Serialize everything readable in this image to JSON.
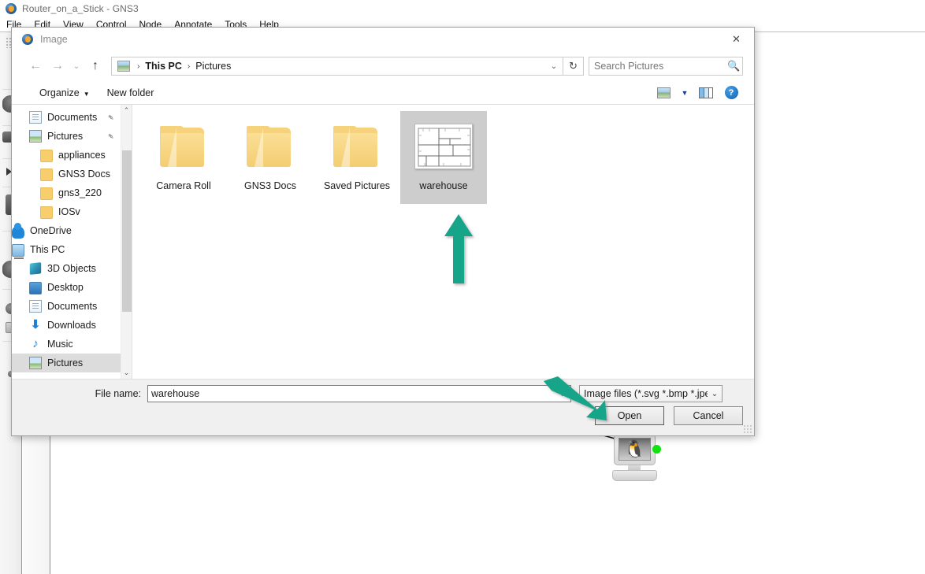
{
  "gns3": {
    "title": "Router_on_a_Stick - GNS3",
    "app_icon": "gns3-logo-icon",
    "menus": [
      "File",
      "Edit",
      "View",
      "Control",
      "Node",
      "Annotate",
      "Tools",
      "Help"
    ],
    "node": {
      "name": "vpc-linux-node",
      "icon": "linux-penguin-icon",
      "link_status_color": "#12e212"
    }
  },
  "dialog": {
    "title": "Image",
    "icon": "gns3-logo-icon",
    "close_label": "✕",
    "nav": {
      "back": "←",
      "forward": "→",
      "recent": "⌄",
      "up": "↑",
      "refresh": "↻"
    },
    "address": {
      "icon": "pictures-folder-icon",
      "crumbs": [
        "This PC",
        "Pictures"
      ],
      "separator": "›",
      "dropdown": "⌄"
    },
    "search": {
      "placeholder": "Search Pictures",
      "value": "",
      "icon": "search-icon"
    },
    "commandbar": {
      "organize": "Organize",
      "organize_caret": "▼",
      "new_folder": "New folder",
      "view_icon": "view-layout-icon",
      "view_caret": "▼",
      "preview_pane_icon": "preview-pane-icon",
      "help_icon": "help-icon",
      "help_glyph": "?"
    },
    "nav_pane": {
      "scroll_up": "⌃",
      "scroll_down": "⌄",
      "items": [
        {
          "label": "Documents",
          "icon": "document-icon",
          "indent": 1,
          "pinned": true,
          "selected": false
        },
        {
          "label": "Pictures",
          "icon": "pictures-icon",
          "indent": 1,
          "pinned": true,
          "selected": false
        },
        {
          "label": "appliances",
          "icon": "folder-icon",
          "indent": 2,
          "pinned": false,
          "selected": false
        },
        {
          "label": "GNS3 Docs",
          "icon": "folder-icon",
          "indent": 2,
          "pinned": false,
          "selected": false
        },
        {
          "label": "gns3_220",
          "icon": "folder-icon",
          "indent": 2,
          "pinned": false,
          "selected": false
        },
        {
          "label": "IOSv",
          "icon": "folder-icon",
          "indent": 2,
          "pinned": false,
          "selected": false
        },
        {
          "label": "OneDrive",
          "icon": "onedrive-cloud-icon",
          "indent": 0,
          "pinned": false,
          "selected": false
        },
        {
          "label": "This PC",
          "icon": "this-pc-icon",
          "indent": 0,
          "pinned": false,
          "selected": false
        },
        {
          "label": "3D Objects",
          "icon": "3d-objects-icon",
          "indent": 1,
          "pinned": false,
          "selected": false
        },
        {
          "label": "Desktop",
          "icon": "desktop-icon",
          "indent": 1,
          "pinned": false,
          "selected": false
        },
        {
          "label": "Documents",
          "icon": "document-icon",
          "indent": 1,
          "pinned": false,
          "selected": false
        },
        {
          "label": "Downloads",
          "icon": "download-icon",
          "indent": 1,
          "pinned": false,
          "selected": false
        },
        {
          "label": "Music",
          "icon": "music-icon",
          "indent": 1,
          "pinned": false,
          "selected": false
        },
        {
          "label": "Pictures",
          "icon": "pictures-icon",
          "indent": 1,
          "pinned": false,
          "selected": true
        }
      ]
    },
    "files": [
      {
        "name": "Camera Roll",
        "type": "folder",
        "selected": false
      },
      {
        "name": "GNS3 Docs",
        "type": "folder",
        "selected": false
      },
      {
        "name": "Saved Pictures",
        "type": "folder",
        "selected": false
      },
      {
        "name": "warehouse",
        "type": "image",
        "selected": true,
        "thumbnail": "floor-plan-drawing"
      }
    ],
    "footer": {
      "filename_label": "File name:",
      "filename_value": "warehouse",
      "filename_caret": "⌄",
      "filetype_value": "Image files (*.svg *.bmp *.jpeg",
      "filetype_caret": "⌄",
      "open_label": "Open",
      "cancel_label": "Cancel"
    }
  },
  "annotations": {
    "color": "#17a589",
    "arrows": [
      {
        "name": "arrow-pointing-to-warehouse-thumbnail",
        "direction": "up"
      },
      {
        "name": "arrow-pointing-to-open-button",
        "direction": "down-right"
      }
    ]
  }
}
